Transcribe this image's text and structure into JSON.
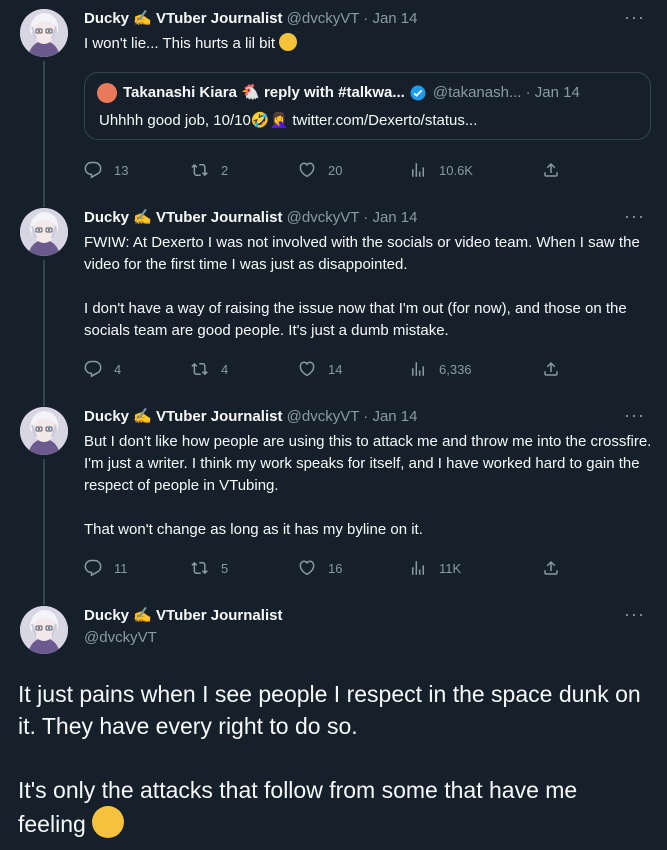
{
  "author": {
    "name": "Ducky ✍️ VTuber Journalist",
    "handle": "@dvckyVT"
  },
  "more_label": "···",
  "tweets": [
    {
      "date": "Jan 14",
      "text": "I won't lie... This hurts a lil bit",
      "quote": {
        "name": "Takanashi Kiara 🐔 reply with #talkwa...",
        "handle": "@takanash...",
        "date": "Jan 14",
        "text": "Uhhhh good job, 10/10🤣🤦‍♀️ twitter.com/Dexerto/status..."
      },
      "replies": "13",
      "retweets": "2",
      "likes": "20",
      "views": "10.6K"
    },
    {
      "date": "Jan 14",
      "text": "FWIW: At Dexerto I was not involved with the socials or video team. When I saw the video for the first time I was just as disappointed.\n\nI don't have a way of raising the issue now that I'm out (for now), and those on the socials team are good people. It's just a dumb mistake.",
      "replies": "4",
      "retweets": "4",
      "likes": "14",
      "views": "6,336"
    },
    {
      "date": "Jan 14",
      "text": "But I don't like how people are using this to attack me and throw me into the crossfire. I'm just a writer. I think my work speaks for itself, and I have worked hard to gain the respect of people in VTubing.\n\nThat won't change as long as it has my byline on it.",
      "replies": "11",
      "retweets": "5",
      "likes": "16",
      "views": "11K"
    }
  ],
  "main_tweet": {
    "text_1": "It just pains when I see people I respect in the space dunk on it. They have every right to do so.",
    "text_2": "It's only the attacks that follow from some that have me feeling"
  },
  "icons": {
    "reply": "reply-icon",
    "retweet": "retweet-icon",
    "like": "heart-icon",
    "views": "views-icon",
    "share": "share-icon",
    "verified": "verified-badge-icon"
  },
  "colors": {
    "background": "#15202b",
    "text": "#f7f9f9",
    "muted": "#8b98a5",
    "border": "#38444d",
    "verified": "#1d9bf0"
  }
}
